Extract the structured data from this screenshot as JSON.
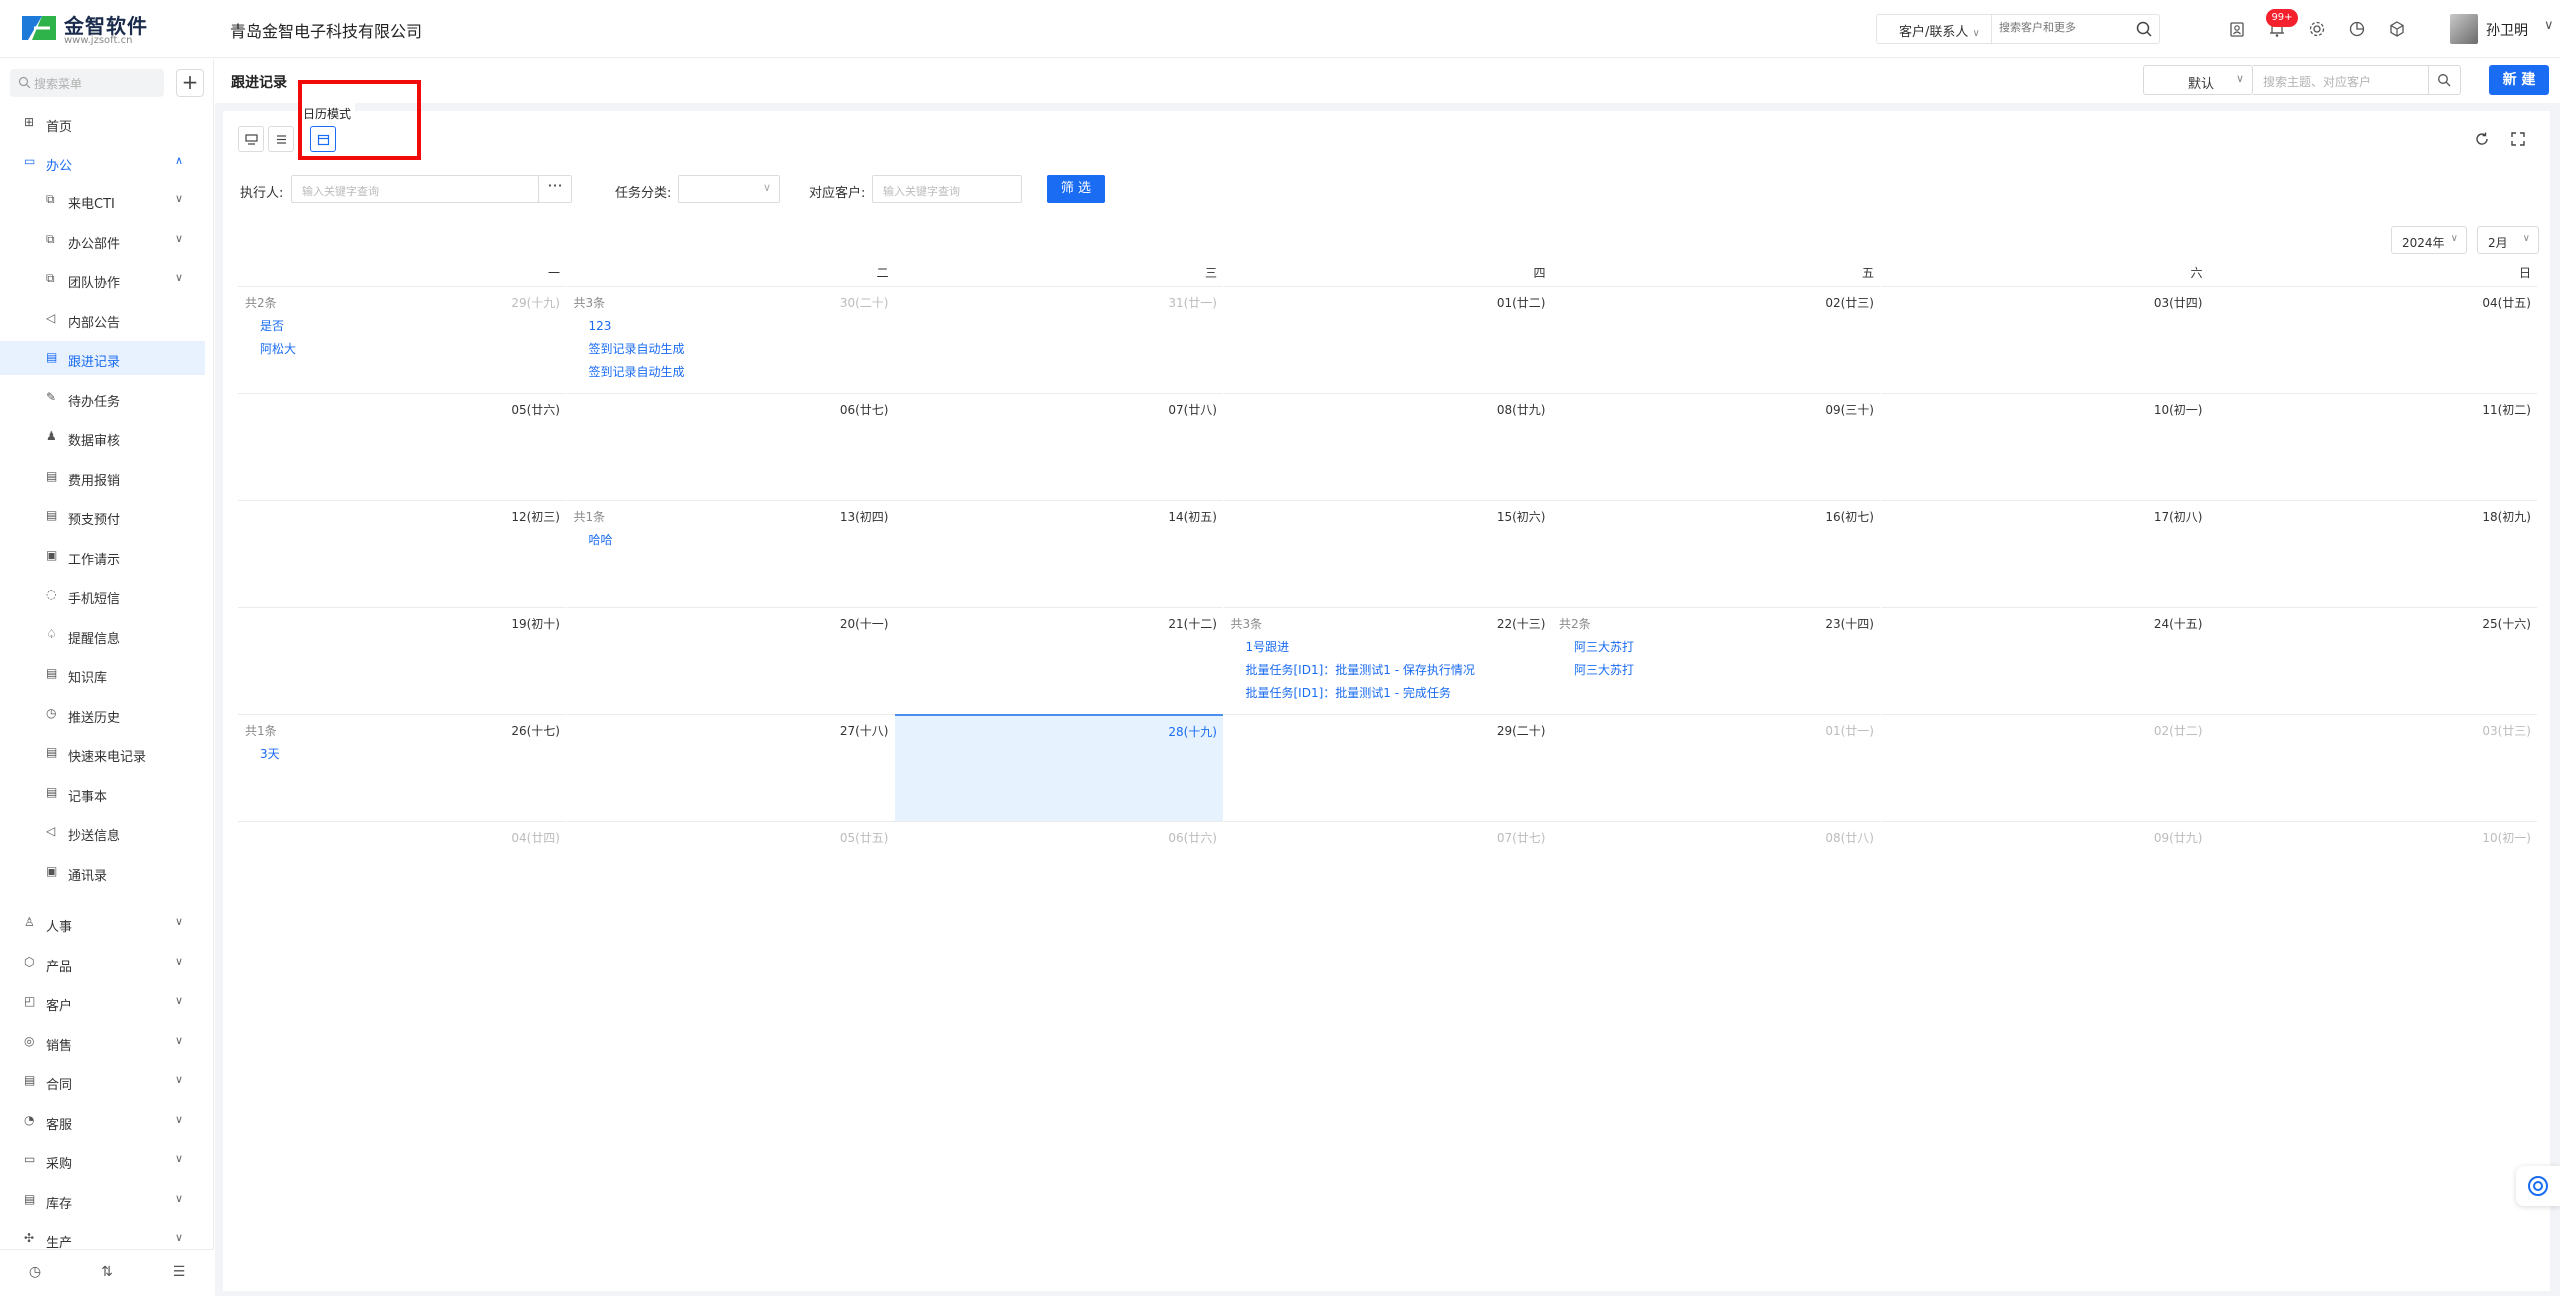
{
  "app": {
    "logo_name": "金智软件",
    "logo_url": "www.jzsoft.cn",
    "company": "青岛金智电子科技有限公司"
  },
  "topbar": {
    "search_scope": "客户/联系人",
    "search_placeholder": "搜索客户和更多",
    "badge": "99+",
    "user_name": "孙卫明"
  },
  "sidebar": {
    "search_placeholder": "搜索菜单",
    "home": "首页",
    "office": "办公",
    "office_items": [
      {
        "label": "来电CTI",
        "icon": "⧉",
        "chev": true
      },
      {
        "label": "办公部件",
        "icon": "⧉",
        "chev": true
      },
      {
        "label": "团队协作",
        "icon": "⧉",
        "chev": true
      },
      {
        "label": "内部公告",
        "icon": "◁",
        "chev": false
      },
      {
        "label": "跟进记录",
        "icon": "▤",
        "chev": false
      },
      {
        "label": "待办任务",
        "icon": "✎",
        "chev": false
      },
      {
        "label": "数据审核",
        "icon": "♟",
        "chev": false
      },
      {
        "label": "费用报销",
        "icon": "▤",
        "chev": false
      },
      {
        "label": "预支预付",
        "icon": "▤",
        "chev": false
      },
      {
        "label": "工作请示",
        "icon": "▣",
        "chev": false
      },
      {
        "label": "手机短信",
        "icon": "◌",
        "chev": false
      },
      {
        "label": "提醒信息",
        "icon": "♤",
        "chev": false
      },
      {
        "label": "知识库",
        "icon": "▤",
        "chev": false
      },
      {
        "label": "推送历史",
        "icon": "◷",
        "chev": false
      },
      {
        "label": "快速来电记录",
        "icon": "▤",
        "chev": false
      },
      {
        "label": "记事本",
        "icon": "▤",
        "chev": false
      },
      {
        "label": "抄送信息",
        "icon": "◁",
        "chev": false
      },
      {
        "label": "通讯录",
        "icon": "▣",
        "chev": false
      }
    ],
    "modules": [
      {
        "label": "人事",
        "icon": "♙"
      },
      {
        "label": "产品",
        "icon": "⬡"
      },
      {
        "label": "客户",
        "icon": "◰"
      },
      {
        "label": "销售",
        "icon": "◎"
      },
      {
        "label": "合同",
        "icon": "▤"
      },
      {
        "label": "客服",
        "icon": "◔"
      },
      {
        "label": "采购",
        "icon": "▭"
      },
      {
        "label": "库存",
        "icon": "▤"
      },
      {
        "label": "生产",
        "icon": "✣"
      }
    ]
  },
  "page": {
    "title": "跟进记录",
    "view_select": "默认",
    "search_placeholder": "搜索主题、对应客户",
    "new_button": "新 建",
    "tooltip": "日历模式"
  },
  "filters": {
    "executor_label": "执行人:",
    "executor_placeholder": "输入关键字查询",
    "category_label": "任务分类:",
    "customer_label": "对应客户:",
    "customer_placeholder": "输入关键字查询",
    "filter_button": "筛 选"
  },
  "calendar": {
    "year": "2024年",
    "month": "2月",
    "weekdays": [
      "一",
      "二",
      "三",
      "四",
      "五",
      "六",
      "日"
    ],
    "weeks": [
      [
        {
          "date": "29(十九)",
          "other": true,
          "count": "共2条",
          "events": [
            "是否",
            "阿松大"
          ]
        },
        {
          "date": "30(二十)",
          "other": true,
          "count": "共3条",
          "events": [
            "123",
            "签到记录自动生成",
            "签到记录自动生成"
          ]
        },
        {
          "date": "31(廿一)",
          "other": true
        },
        {
          "date": "01(廿二)"
        },
        {
          "date": "02(廿三)"
        },
        {
          "date": "03(廿四)"
        },
        {
          "date": "04(廿五)"
        }
      ],
      [
        {
          "date": "05(廿六)"
        },
        {
          "date": "06(廿七)"
        },
        {
          "date": "07(廿八)"
        },
        {
          "date": "08(廿九)"
        },
        {
          "date": "09(三十)"
        },
        {
          "date": "10(初一)"
        },
        {
          "date": "11(初二)"
        }
      ],
      [
        {
          "date": "12(初三)"
        },
        {
          "date": "13(初四)",
          "count": "共1条",
          "events": [
            "哈哈"
          ]
        },
        {
          "date": "14(初五)"
        },
        {
          "date": "15(初六)"
        },
        {
          "date": "16(初七)"
        },
        {
          "date": "17(初八)"
        },
        {
          "date": "18(初九)"
        }
      ],
      [
        {
          "date": "19(初十)"
        },
        {
          "date": "20(十一)"
        },
        {
          "date": "21(十二)"
        },
        {
          "date": "22(十三)",
          "count": "共3条",
          "events": [
            "1号跟进",
            "批量任务[ID1]：批量测试1 - 保存执行情况",
            "批量任务[ID1]：批量测试1 - 完成任务"
          ]
        },
        {
          "date": "23(十四)",
          "count": "共2条",
          "events": [
            "阿三大苏打",
            "阿三大苏打"
          ]
        },
        {
          "date": "24(十五)"
        },
        {
          "date": "25(十六)"
        }
      ],
      [
        {
          "date": "26(十七)",
          "count": "共1条",
          "events": [
            "3天"
          ]
        },
        {
          "date": "27(十八)"
        },
        {
          "date": "28(十九)",
          "today": true
        },
        {
          "date": "29(二十)"
        },
        {
          "date": "01(廿一)",
          "other": true
        },
        {
          "date": "02(廿二)",
          "other": true
        },
        {
          "date": "03(廿三)",
          "other": true
        }
      ],
      [
        {
          "date": "04(廿四)",
          "other": true
        },
        {
          "date": "05(廿五)",
          "other": true
        },
        {
          "date": "06(廿六)",
          "other": true
        },
        {
          "date": "07(廿七)",
          "other": true
        },
        {
          "date": "08(廿八)",
          "other": true
        },
        {
          "date": "09(廿九)",
          "other": true
        },
        {
          "date": "10(初一)",
          "other": true
        }
      ]
    ]
  },
  "colors": {
    "primary": "#1a6cf2",
    "highlight": "#f00a0a",
    "today_bg": "#e6f2fd"
  }
}
